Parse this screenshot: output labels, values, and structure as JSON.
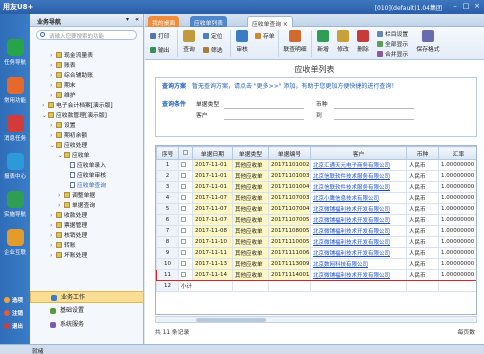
{
  "app": {
    "logo": "用友U8+",
    "info": "[010](default)1.04集团"
  },
  "window": {
    "min_icon": "minimize-icon",
    "max_icon": "maximize-icon",
    "close_icon": "close-icon"
  },
  "leftbar": {
    "items": [
      {
        "label": "任务导航",
        "icon": "task-icon",
        "color": "#27a34a"
      },
      {
        "label": "常用功能",
        "icon": "star-icon",
        "color": "#e7682b"
      },
      {
        "label": "消息任务",
        "icon": "message-icon",
        "color": "#d33b3b"
      },
      {
        "label": "报表中心",
        "icon": "report-icon",
        "color": "#2d9ad8"
      },
      {
        "label": "实施导航",
        "icon": "implement-icon",
        "color": "#2f9d53"
      },
      {
        "label": "企业互联",
        "icon": "network-icon",
        "color": "#e39b2c"
      }
    ],
    "bottom": [
      {
        "label": "选项",
        "color": "#f2a33a"
      },
      {
        "label": "注销",
        "color": "#e25b3c"
      },
      {
        "label": "退出",
        "color": "#d33b3b"
      }
    ]
  },
  "tree": {
    "title": "业务导航",
    "search_placeholder": "请输入您要搜索的功能",
    "nodes": [
      {
        "label": "现金流量表",
        "level": 2,
        "arrow": "›"
      },
      {
        "label": "账表",
        "level": 2,
        "arrow": "›"
      },
      {
        "label": "综合辅助账",
        "level": 2,
        "arrow": "›"
      },
      {
        "label": "期末",
        "level": 2,
        "arrow": "›"
      },
      {
        "label": "维护",
        "level": 2,
        "arrow": "›"
      },
      {
        "label": "电子会计档案[演示版]",
        "level": 1,
        "arrow": "›"
      },
      {
        "label": "应收款管理[演示版]",
        "level": 1,
        "arrow": "⌄"
      },
      {
        "label": "设置",
        "level": 2,
        "arrow": "›"
      },
      {
        "label": "期初余额",
        "level": 2,
        "arrow": "›"
      },
      {
        "label": "应收处理",
        "level": 2,
        "arrow": "⌄"
      },
      {
        "label": "应收单",
        "level": 3,
        "arrow": "⌄"
      },
      {
        "label": "应收单录入",
        "level": 4,
        "arrow": ""
      },
      {
        "label": "应收单审核",
        "level": 4,
        "arrow": ""
      },
      {
        "label": "应收单查询",
        "level": 4,
        "arrow": "",
        "selected": true
      },
      {
        "label": "调整单据",
        "level": 3,
        "arrow": "›"
      },
      {
        "label": "单据查询",
        "level": 3,
        "arrow": "›"
      },
      {
        "label": "收款处理",
        "level": 2,
        "arrow": "›"
      },
      {
        "label": "票据管理",
        "level": 2,
        "arrow": "›"
      },
      {
        "label": "核销处理",
        "level": 2,
        "arrow": "›"
      },
      {
        "label": "转账",
        "level": 2,
        "arrow": "›"
      },
      {
        "label": "坏账处理",
        "level": 2,
        "arrow": "›"
      }
    ],
    "bottom": [
      {
        "label": "业务工作",
        "active": true,
        "color": "#3a7cc6"
      },
      {
        "label": "基础设置",
        "active": false,
        "color": "#5a9a3a"
      },
      {
        "label": "系统服务",
        "active": false,
        "color": "#7a5ab0"
      }
    ]
  },
  "tabs": [
    {
      "label": "我的桌面"
    },
    {
      "label": "应收单列表"
    },
    {
      "label": "应收单查询",
      "close": "×"
    }
  ],
  "toolbar": {
    "row1": [
      {
        "label": "打印",
        "icon": "print-icon",
        "color": "#5477b0"
      },
      {
        "label": "输出",
        "icon": "export-icon",
        "color": "#3a8f55"
      },
      {
        "label": "查询",
        "icon": "query-icon",
        "color": "#c09a3c"
      },
      {
        "label": "定位",
        "icon": "locate-icon",
        "color": "#4a7fc0"
      },
      {
        "label": "存单",
        "icon": "save-icon",
        "color": "#d0882e"
      },
      {
        "label": "栏目设置",
        "icon": "column-icon",
        "color": "#6a86b8"
      }
    ],
    "row2": [
      {
        "label": "筛选",
        "icon": "filter-icon",
        "color": "#b07a3a"
      },
      {
        "label": "全部显示",
        "icon": "show-all-icon",
        "color": "#58a05a"
      },
      {
        "label": "合并显示",
        "icon": "merge-icon",
        "color": "#8a5a9a"
      }
    ],
    "big": [
      {
        "label": "审核",
        "icon": "audit-icon",
        "color": "#3a7cc6"
      },
      {
        "label": "联查明细",
        "icon": "detail-icon",
        "color": "#d06a2e"
      },
      {
        "label": "新增",
        "icon": "new-icon",
        "color": "#2f9d53"
      },
      {
        "label": "修改",
        "icon": "edit-icon",
        "color": "#c9a03a"
      },
      {
        "label": "删除",
        "icon": "delete-icon",
        "color": "#c93a3a"
      },
      {
        "label": "保存格式",
        "icon": "format-icon",
        "color": "#6a6ab0"
      }
    ]
  },
  "page_title": "应收单列表",
  "query": {
    "scheme_label": "查询方案",
    "scheme_text": "暂无查询方案，请点击 \"更多>>\" 添加，有助于您更加方便快捷的进行查询！",
    "cond_label": "查询条件",
    "fields": [
      {
        "label": "单据类型"
      },
      {
        "label": "币种"
      },
      {
        "label": "客户"
      },
      {
        "label": "到"
      }
    ]
  },
  "grid": {
    "headers": [
      "序号",
      "",
      "单据日期",
      "单据类型",
      "单据编号",
      "客户",
      "币种",
      "汇率"
    ],
    "rows": [
      {
        "n": "1",
        "date": "2017-11-01",
        "type": "其他应收单",
        "no": "20171101002",
        "cust": "北京汇通天元电子商务有限公司",
        "cur": "人民币",
        "rate": "1.00000000"
      },
      {
        "n": "2",
        "date": "2017-11-01",
        "type": "其他应收单",
        "no": "20171101003",
        "cust": "北京信联软件技术服务有限公司",
        "cur": "人民币",
        "rate": "1.00000000"
      },
      {
        "n": "3",
        "date": "2017-11-01",
        "type": "其他应收单",
        "no": "20171101004",
        "cust": "北京信联软件技术服务有限公司",
        "cur": "人民币",
        "rate": "1.00000000"
      },
      {
        "n": "4",
        "date": "2017-11-07",
        "type": "其他应收单",
        "no": "20171107003",
        "cust": "北京小鹰信息技术有限公司",
        "cur": "人民币",
        "rate": "1.00000000"
      },
      {
        "n": "5",
        "date": "2017-11-07",
        "type": "其他应收单",
        "no": "20171107004",
        "cust": "北京微铺福利技术开发有限公司",
        "cur": "人民币",
        "rate": "1.00000000"
      },
      {
        "n": "6",
        "date": "2017-11-07",
        "type": "其他应收单",
        "no": "20171107005",
        "cust": "北京微铺福利技术开发有限公司",
        "cur": "人民币",
        "rate": "1.00000000"
      },
      {
        "n": "7",
        "date": "2017-11-08",
        "type": "其他应收单",
        "no": "20171108005",
        "cust": "北京微铺福利技术开发有限公司",
        "cur": "人民币",
        "rate": "1.00000000"
      },
      {
        "n": "8",
        "date": "2017-11-10",
        "type": "其他应收单",
        "no": "20171110005",
        "cust": "北京微铺福利技术开发有限公司",
        "cur": "人民币",
        "rate": "1.00000000"
      },
      {
        "n": "9",
        "date": "2017-11-11",
        "type": "其他应收单",
        "no": "20171111006",
        "cust": "北京微铺福利技术开发有限公司",
        "cur": "人民币",
        "rate": "1.00000000"
      },
      {
        "n": "10",
        "date": "2017-11-13",
        "type": "其他应收单",
        "no": "20171113009",
        "cust": "北京数网科技有限公司",
        "cur": "人民币",
        "rate": "1.00000000"
      },
      {
        "n": "11",
        "date": "2017-11-14",
        "type": "其他应收单",
        "no": "20171114001",
        "cust": "北京微铺福利技术开发有限公司",
        "cur": "人民币",
        "rate": "1.00000000",
        "selected": true
      },
      {
        "n": "12",
        "date": "",
        "type": "",
        "no": "",
        "cust": "",
        "cur": "",
        "rate": "",
        "subtotal": "小计"
      }
    ]
  },
  "footer": {
    "count": "共 11 条记录",
    "right": "每页数"
  },
  "status": {
    "text": "就绪"
  }
}
